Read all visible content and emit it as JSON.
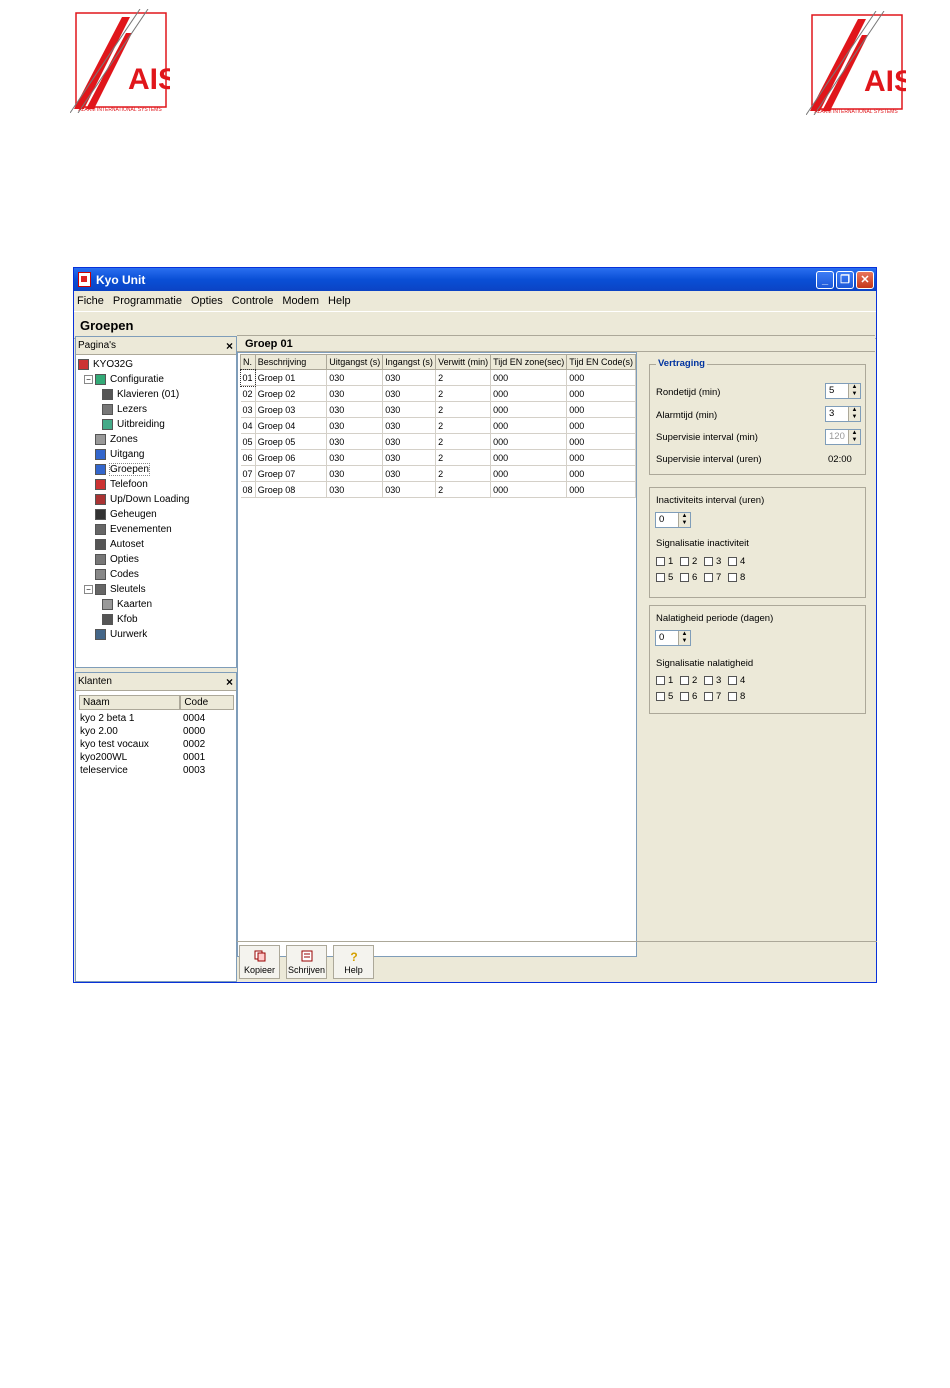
{
  "logos": {
    "brand_text": "AIS",
    "caption": "ALARM INTERNATIONAL SYSTEMS"
  },
  "window": {
    "title": "Kyo Unit",
    "minimize": "_",
    "restore": "❐",
    "close": "✕"
  },
  "menu": [
    "Fiche",
    "Programmatie",
    "Opties",
    "Controle",
    "Modem",
    "Help"
  ],
  "page_title": "Groepen",
  "pages_panel": {
    "title": "Pagina's",
    "close": "×",
    "tree": [
      {
        "label": "KYO32G",
        "level": 0,
        "icon": "unit-icon"
      },
      {
        "label": "Configuratie",
        "level": 1,
        "icon": "config-icon",
        "expander": "−"
      },
      {
        "label": "Klavieren (01)",
        "level": 2,
        "icon": "keypad-icon"
      },
      {
        "label": "Lezers",
        "level": 2,
        "icon": "reader-icon"
      },
      {
        "label": "Uitbreiding",
        "level": 2,
        "icon": "expansion-icon"
      },
      {
        "label": "Zones",
        "level": 1,
        "icon": "zones-icon"
      },
      {
        "label": "Uitgang",
        "level": 1,
        "icon": "output-icon"
      },
      {
        "label": "Groepen",
        "level": 1,
        "icon": "groups-icon"
      },
      {
        "label": "Telefoon",
        "level": 1,
        "icon": "phone-icon"
      },
      {
        "label": "Up/Down Loading",
        "level": 1,
        "icon": "updown-icon"
      },
      {
        "label": "Geheugen",
        "level": 1,
        "icon": "memory-icon"
      },
      {
        "label": "Evenementen",
        "level": 1,
        "icon": "events-icon"
      },
      {
        "label": "Autoset",
        "level": 1,
        "icon": "autoset-icon"
      },
      {
        "label": "Opties",
        "level": 1,
        "icon": "options-icon"
      },
      {
        "label": "Codes",
        "level": 1,
        "icon": "codes-icon"
      },
      {
        "label": "Sleutels",
        "level": 1,
        "icon": "keys-icon",
        "expander": "−"
      },
      {
        "label": "Kaarten",
        "level": 2,
        "icon": "card-icon"
      },
      {
        "label": "Kfob",
        "level": 2,
        "icon": "kfob-icon"
      },
      {
        "label": "Uurwerk",
        "level": 1,
        "icon": "clock-icon"
      }
    ]
  },
  "clients_panel": {
    "title": "Klanten",
    "close": "×",
    "columns": [
      "Naam",
      "Code"
    ],
    "rows": [
      [
        "kyo 2 beta 1",
        "0004"
      ],
      [
        "kyo 2.00",
        "0000"
      ],
      [
        "kyo test vocaux",
        "0002"
      ],
      [
        "kyo200WL",
        "0001"
      ],
      [
        "teleservice",
        "0003"
      ]
    ]
  },
  "group_header": "Groep 01",
  "group_table": {
    "columns": [
      "N.",
      "Beschrijving",
      "Uitgangst (s)",
      "Ingangst (s)",
      "Verwitt (min)",
      "Tijd EN zone(sec)",
      "Tijd EN Code(s)"
    ],
    "rows": [
      [
        "01",
        "Groep 01",
        "030",
        "030",
        "2",
        "000",
        "000"
      ],
      [
        "02",
        "Groep 02",
        "030",
        "030",
        "2",
        "000",
        "000"
      ],
      [
        "03",
        "Groep 03",
        "030",
        "030",
        "2",
        "000",
        "000"
      ],
      [
        "04",
        "Groep 04",
        "030",
        "030",
        "2",
        "000",
        "000"
      ],
      [
        "05",
        "Groep 05",
        "030",
        "030",
        "2",
        "000",
        "000"
      ],
      [
        "06",
        "Groep 06",
        "030",
        "030",
        "2",
        "000",
        "000"
      ],
      [
        "07",
        "Groep 07",
        "030",
        "030",
        "2",
        "000",
        "000"
      ],
      [
        "08",
        "Groep 08",
        "030",
        "030",
        "2",
        "000",
        "000"
      ]
    ]
  },
  "vertraging": {
    "title": "Vertraging",
    "rondetijd_label": "Rondetijd (min)",
    "rondetijd_value": "5",
    "alarmtijd_label": "Alarmtijd (min)",
    "alarmtijd_value": "3",
    "supervisie_min_label": "Supervisie interval (min)",
    "supervisie_min_value": "120",
    "supervisie_uren_label": "Supervisie interval (uren)",
    "supervisie_uren_value": "02:00"
  },
  "inactiviteit": {
    "interval_label": "Inactiviteits interval (uren)",
    "interval_value": "0",
    "signal_label": "Signalisatie inactiviteit",
    "checks": [
      "1",
      "2",
      "3",
      "4",
      "5",
      "6",
      "7",
      "8"
    ]
  },
  "nalatigheid": {
    "period_label": "Nalatigheid periode (dagen)",
    "period_value": "0",
    "signal_label": "Signalisatie nalatigheid",
    "checks": [
      "1",
      "2",
      "3",
      "4",
      "5",
      "6",
      "7",
      "8"
    ]
  },
  "bottom_buttons": [
    "Kopieer",
    "Schrijven",
    "Help"
  ],
  "colors": {
    "titlebar": "#0a4fd6",
    "logo_red": "#e0161b",
    "window_bg": "#ece9d8"
  }
}
